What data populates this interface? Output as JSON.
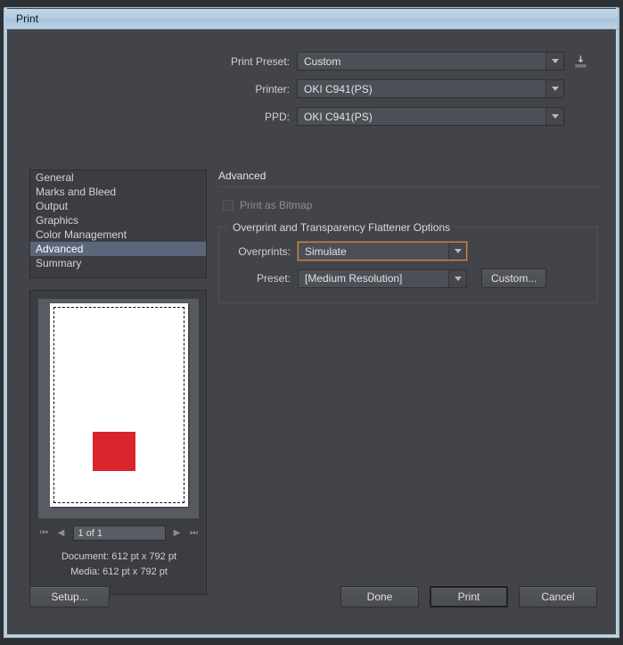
{
  "window": {
    "title": "Print"
  },
  "top_form": {
    "rows": [
      {
        "label": "Print Preset:",
        "value": "Custom",
        "name": "print-preset"
      },
      {
        "label": "Printer:",
        "value": "OKI C941(PS)",
        "name": "printer"
      },
      {
        "label": "PPD:",
        "value": "OKI C941(PS)",
        "name": "ppd"
      }
    ],
    "save_preset_icon": "save-preset-icon"
  },
  "sidebar": {
    "items": [
      {
        "label": "General",
        "selected": false
      },
      {
        "label": "Marks and Bleed",
        "selected": false
      },
      {
        "label": "Output",
        "selected": false
      },
      {
        "label": "Graphics",
        "selected": false
      },
      {
        "label": "Color Management",
        "selected": false
      },
      {
        "label": "Advanced",
        "selected": true
      },
      {
        "label": "Summary",
        "selected": false
      }
    ]
  },
  "preview": {
    "page_field_value": "1 of 1",
    "nav": {
      "first": "⏮",
      "prev": "◀",
      "next": "▶",
      "last": "⏭"
    },
    "document_label": "Document: 612 pt x 792 pt",
    "media_label": "Media: 612 pt x 792 pt",
    "art_color": "#d9252b",
    "page_color": "#ffffff"
  },
  "content": {
    "title": "Advanced",
    "print_as_bitmap": {
      "label": "Print as Bitmap",
      "checked": false,
      "enabled": false
    },
    "group": {
      "legend": "Overprint and Transparency Flattener Options",
      "overprints": {
        "label": "Overprints:",
        "value": "Simulate",
        "focused": true
      },
      "preset": {
        "label": "Preset:",
        "value": "[Medium Resolution]"
      },
      "custom_button": "Custom..."
    }
  },
  "footer": {
    "setup": "Setup...",
    "done": "Done",
    "print": "Print",
    "cancel": "Cancel"
  },
  "colors": {
    "dialog_bg": "#43444a",
    "panel_bg": "#3c3d43",
    "selection": "#5c677c",
    "focus_ring": "#d08b3c",
    "title_bar": "#b1cbe0"
  }
}
